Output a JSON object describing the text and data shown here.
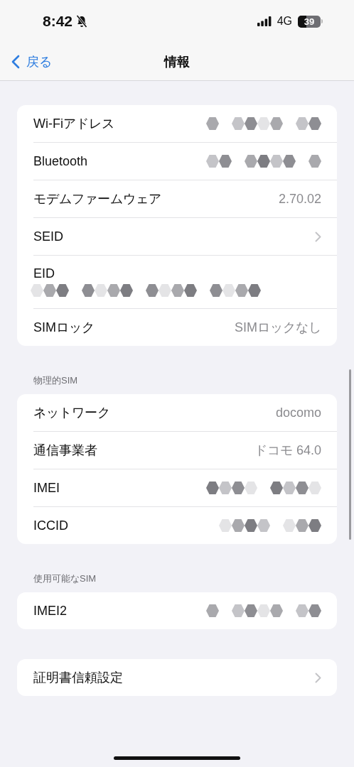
{
  "status_bar": {
    "time": "8:42",
    "silent": true,
    "network": "4G",
    "battery": "39"
  },
  "nav": {
    "back": "戻る",
    "title": "情報"
  },
  "groups": [
    {
      "rows": [
        {
          "kind": "value",
          "label": "Wi-Fiアドレス",
          "redacted": true
        },
        {
          "kind": "value",
          "label": "Bluetooth",
          "redacted": true
        },
        {
          "kind": "value",
          "label": "モデムファームウェア",
          "value": "2.70.02"
        },
        {
          "kind": "link",
          "label": "SEID"
        },
        {
          "kind": "stacked",
          "label": "EID",
          "redacted": true
        },
        {
          "kind": "value",
          "label": "SIMロック",
          "value": "SIMロックなし"
        }
      ]
    },
    {
      "header": "物理的SIM",
      "rows": [
        {
          "kind": "value",
          "label": "ネットワーク",
          "value": "docomo"
        },
        {
          "kind": "value",
          "label": "通信事業者",
          "value": "ドコモ 64.0"
        },
        {
          "kind": "value",
          "label": "IMEI",
          "redacted": true
        },
        {
          "kind": "value",
          "label": "ICCID",
          "redacted": true
        }
      ]
    },
    {
      "header": "使用可能なSIM",
      "rows": [
        {
          "kind": "value",
          "label": "IMEI2",
          "redacted": true
        }
      ]
    },
    {
      "rows": [
        {
          "kind": "link",
          "label": "証明書信頼設定"
        }
      ]
    }
  ]
}
